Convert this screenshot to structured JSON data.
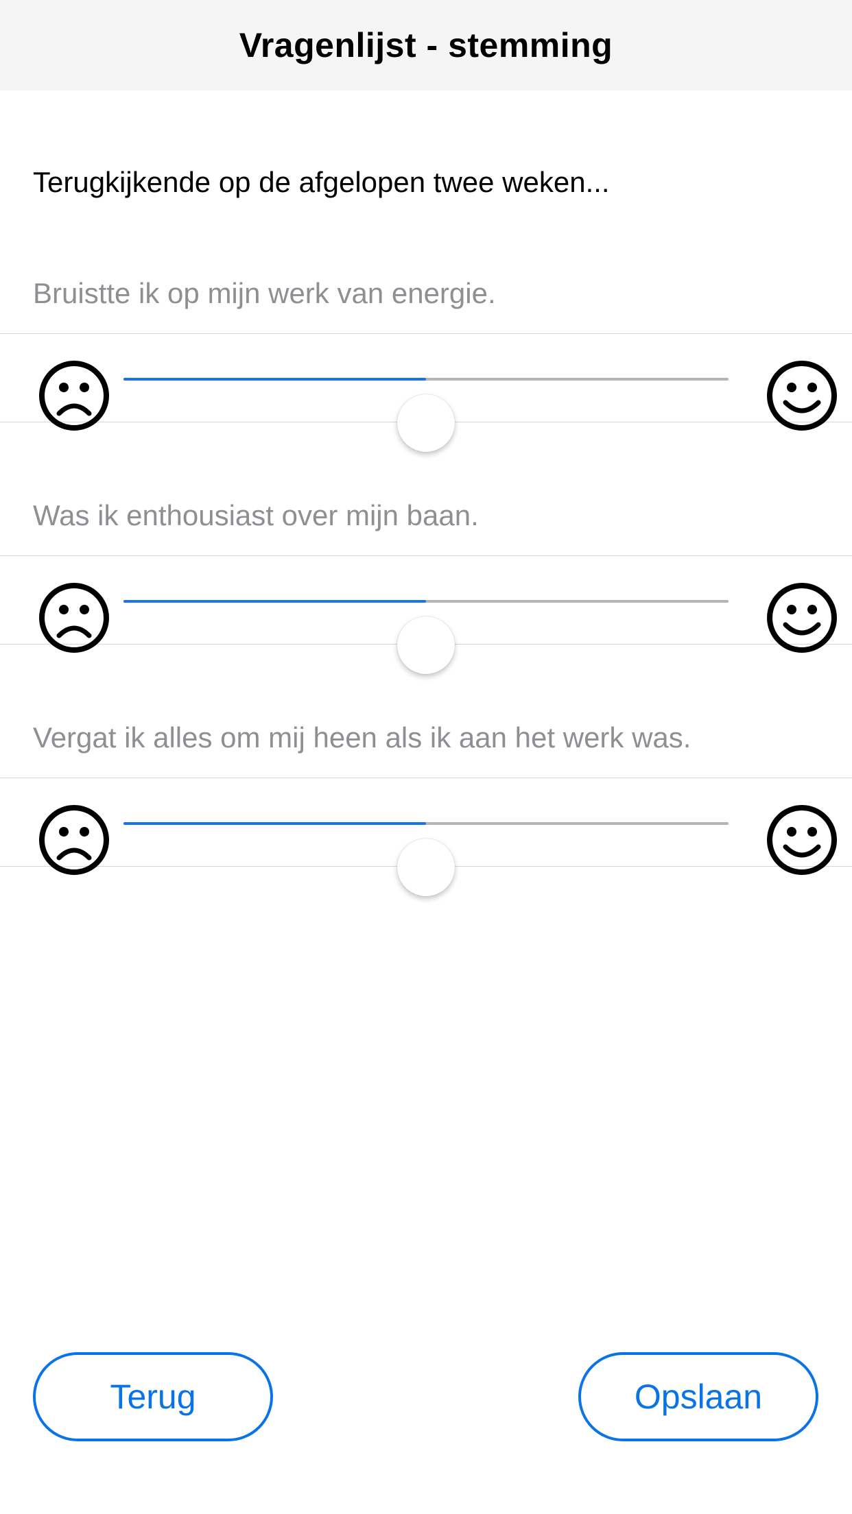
{
  "header": {
    "title": "Vragenlijst - stemming"
  },
  "intro": "Terugkijkende op de afgelopen twee weken...",
  "questions": [
    {
      "label": "Bruistte ik op mijn werk van energie.",
      "value": 0.5
    },
    {
      "label": "Was ik enthousiast over mijn baan.",
      "value": 0.5
    },
    {
      "label": "Vergat ik alles om mij heen als ik aan het werk was.",
      "value": 0.5
    }
  ],
  "slider_icons": {
    "min": "sad-face-icon",
    "max": "happy-face-icon"
  },
  "buttons": {
    "back_label": "Terug",
    "save_label": "Opslaan"
  },
  "colors": {
    "accent": "#0a74e6",
    "track_fill": "#1a73e8",
    "track": "#b5b5b5",
    "question_text": "#8e8e93"
  }
}
